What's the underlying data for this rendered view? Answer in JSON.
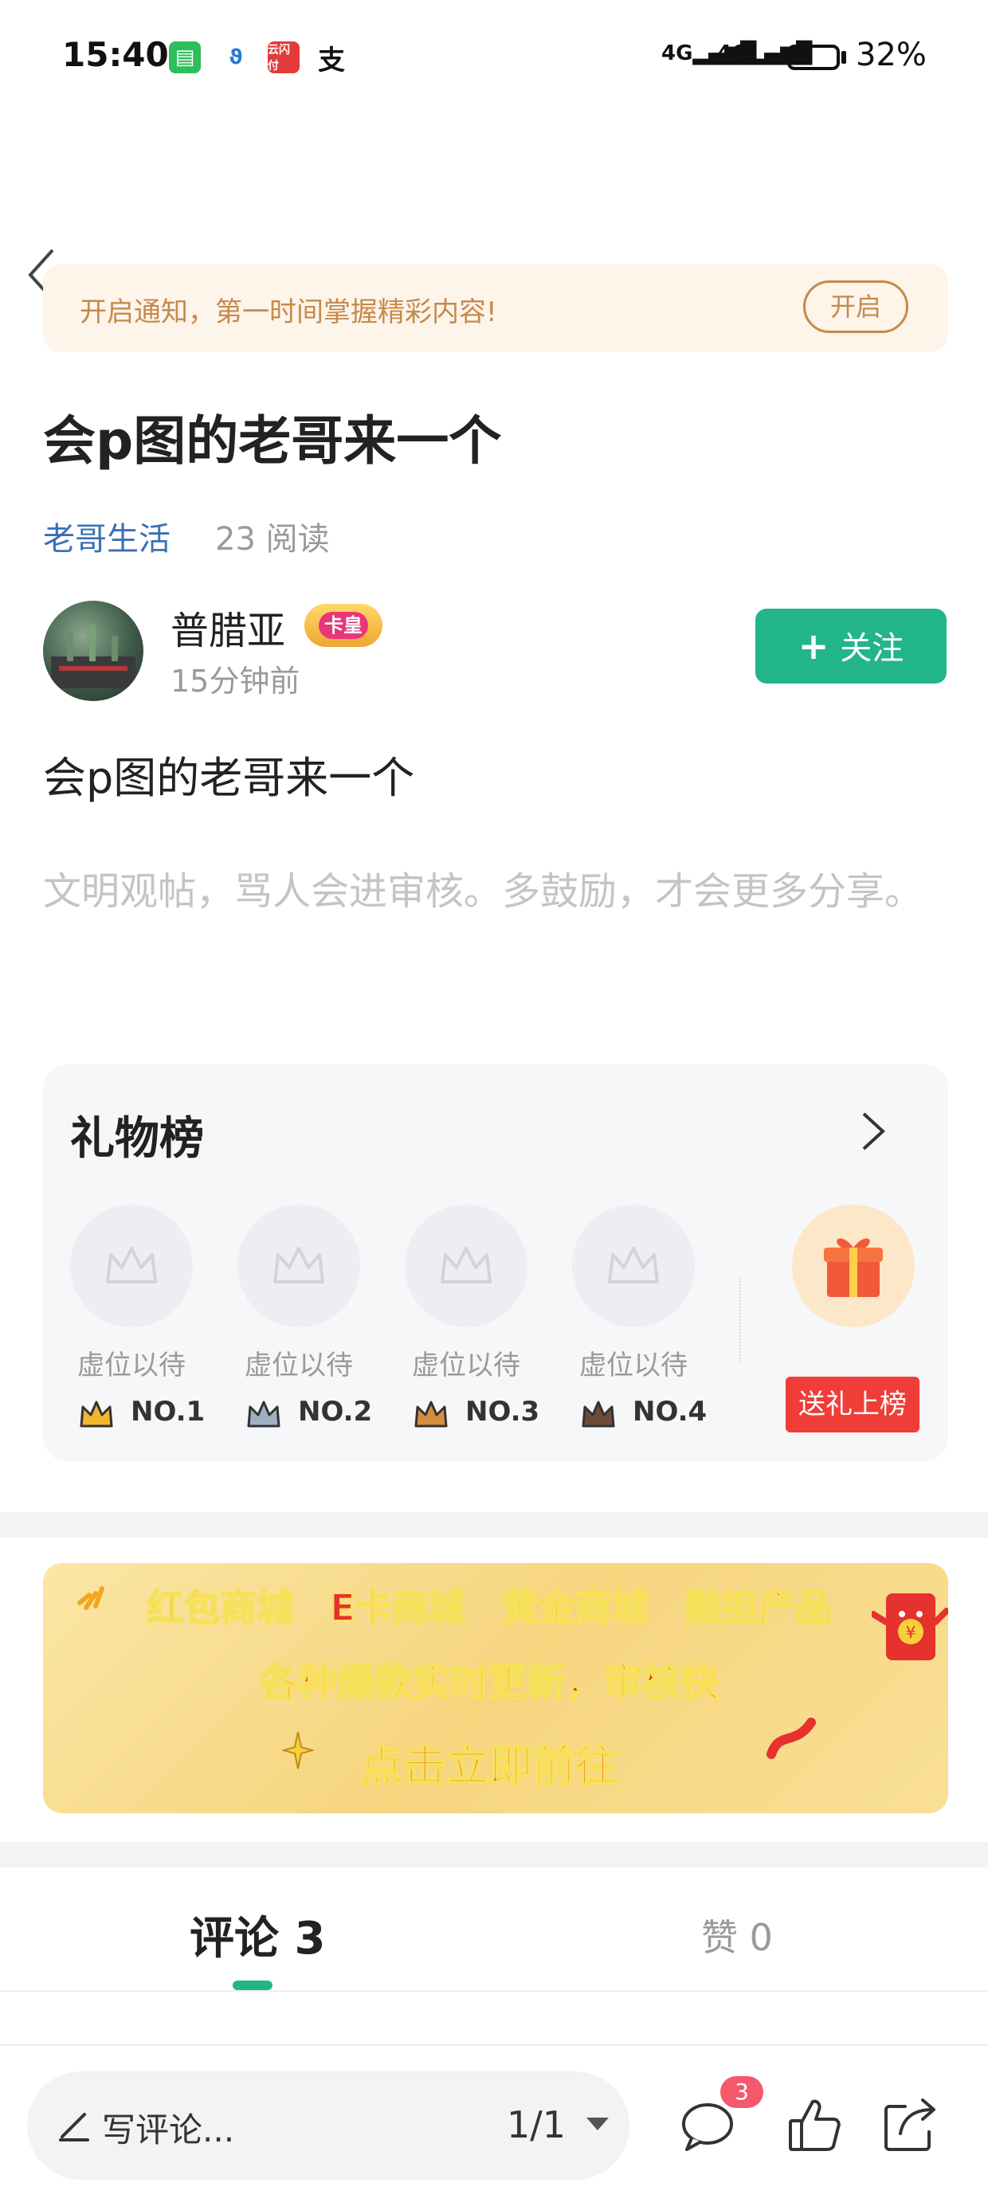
{
  "status_bar": {
    "time": "15:40",
    "battery_percent": "32%",
    "signal1": "4G",
    "signal2": "4G",
    "app_icon_4": "支"
  },
  "nav": {
    "back_icon": "chevron-left-icon",
    "more_icon": "more-horizontal-icon"
  },
  "notice_banner": {
    "text": "开启通知，第一时间掌握精彩内容!",
    "button": "开启"
  },
  "post": {
    "title": "会p图的老哥来一个",
    "category": "老哥生活",
    "reads": "23 阅读",
    "author": "普腊亚",
    "badge": "卡皇",
    "time_ago": "15分钟前",
    "follow_label": "关注",
    "content": "会p图的老哥来一个",
    "hint": "文明观帖，骂人会进审核。多鼓励，才会更多分享。"
  },
  "gift_board": {
    "title": "礼物榜",
    "seats": [
      {
        "label": "虚位以待",
        "rank": "NO.1",
        "crown_color": "#f2b72d"
      },
      {
        "label": "虚位以待",
        "rank": "NO.2",
        "crown_color": "#9fb0c4"
      },
      {
        "label": "虚位以待",
        "rank": "NO.3",
        "crown_color": "#d58f3c"
      },
      {
        "label": "虚位以待",
        "rank": "NO.4",
        "crown_color": "#6f4a3a"
      }
    ],
    "send_button": "送礼上榜"
  },
  "ad_banner": {
    "line1": "红包商城　E卡商城　黄金商城　融担产品",
    "line2": "各种爆款实时更新，审核快",
    "line3": "点击立即前往"
  },
  "tabs": {
    "comments": "评论 3",
    "likes": "赞 0"
  },
  "bottom_bar": {
    "input_placeholder": "写评论...",
    "page": "1/1",
    "comment_count": "3"
  },
  "colors": {
    "accent": "#23b58a",
    "link": "#3b6fb6",
    "banner_text": "#c58a4c",
    "red": "#ef3d37"
  }
}
